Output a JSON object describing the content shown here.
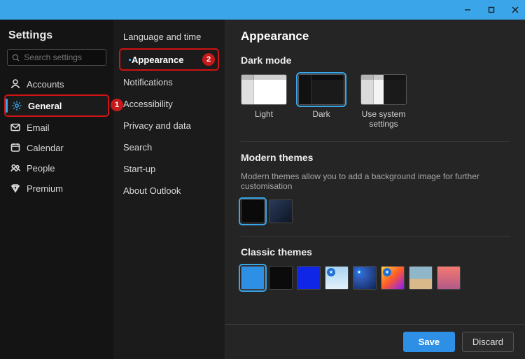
{
  "window": {
    "minimize": "–",
    "maximize": "☐",
    "close": "✕"
  },
  "settings_title": "Settings",
  "search": {
    "placeholder": "Search settings"
  },
  "nav": {
    "accounts": "Accounts",
    "general": "General",
    "email": "Email",
    "calendar": "Calendar",
    "people": "People",
    "premium": "Premium"
  },
  "annotations": {
    "nav_general": "1",
    "mid_appearance": "2"
  },
  "mid": {
    "language_time": "Language and time",
    "appearance": "Appearance",
    "notifications": "Notifications",
    "accessibility": "Accessibility",
    "privacy": "Privacy and data",
    "search": "Search",
    "startup": "Start-up",
    "about": "About Outlook"
  },
  "main": {
    "title": "Appearance",
    "dark_mode": {
      "heading": "Dark mode",
      "light": "Light",
      "dark": "Dark",
      "system": "Use system settings"
    },
    "modern": {
      "heading": "Modern themes",
      "desc": "Modern themes allow you to add a background image for further customisation"
    },
    "classic": {
      "heading": "Classic themes"
    }
  },
  "footer": {
    "save": "Save",
    "discard": "Discard"
  },
  "colors": {
    "accent": "#3aa5e8",
    "annotation_red": "#c61a1a",
    "classic_swatches": [
      "#2e90e5",
      "#0b0b0b",
      "#1026e6",
      "img-sky",
      "img-star",
      "img-orange",
      "img-beach",
      "img-sunset"
    ]
  }
}
